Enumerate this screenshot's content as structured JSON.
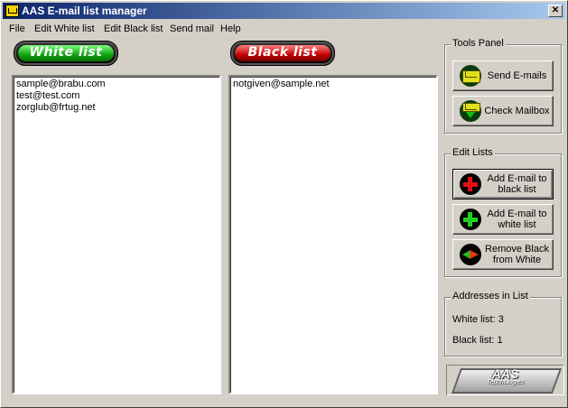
{
  "window": {
    "title": "AAS E-mail list manager",
    "close_glyph": "✕"
  },
  "menu": [
    "File",
    "Edit White list",
    "Edit Black list",
    "Send mail",
    "Help"
  ],
  "white_list": {
    "header": "White list",
    "items": [
      "sample@brabu.com",
      "test@test.com",
      "zorglub@frtug.net"
    ]
  },
  "black_list": {
    "header": "Black list",
    "items": [
      "notgiven@sample.net"
    ]
  },
  "tools_panel": {
    "legend": "Tools Panel",
    "send_label": "Send E-mails",
    "check_label": "Check Mailbox"
  },
  "edit_lists": {
    "legend": "Edit Lists",
    "add_black_label": "Add E-mail to black list",
    "add_white_label": "Add E-mail to white list",
    "remove_label": "Remove Black from White"
  },
  "addresses": {
    "legend": "Addresses in List",
    "white_count": "White list: 3",
    "black_count": "Black list: 1"
  },
  "logo": {
    "brand": "AAS",
    "sub": "Technologies"
  },
  "colors": {
    "title_start": "#0a246a",
    "title_end": "#a6caf0",
    "white_pill": "#10a010",
    "black_pill": "#c00000"
  },
  "icons": {
    "send": "envelope-icon",
    "check": "mailbox-arrow-icon",
    "add_black": "red-plus-icon",
    "add_white": "green-plus-icon",
    "remove": "swap-arrows-icon"
  }
}
